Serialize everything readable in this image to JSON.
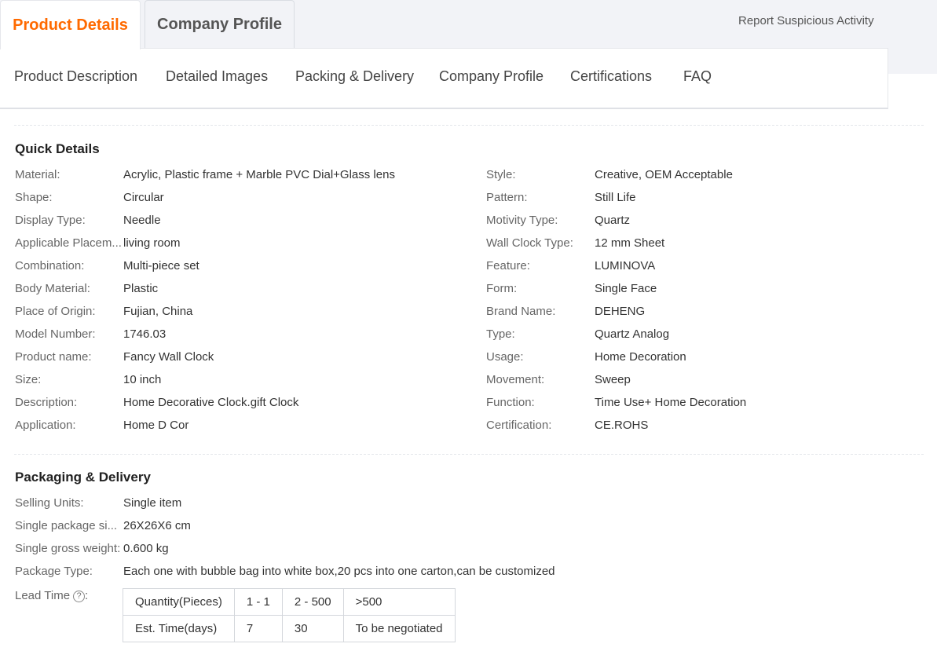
{
  "tabs": {
    "active": "Product Details",
    "inactive": "Company Profile"
  },
  "report_link": "Report Suspicious Activity",
  "sub_nav": [
    "Product Description",
    "Detailed Images",
    "Packing & Delivery",
    "Company Profile",
    "Certifications",
    "FAQ"
  ],
  "quick_details": {
    "title": "Quick Details",
    "left": [
      {
        "k": "Material:",
        "v": "Acrylic, Plastic frame + Marble PVC Dial+Glass lens"
      },
      {
        "k": "Shape:",
        "v": "Circular"
      },
      {
        "k": "Display Type:",
        "v": "Needle"
      },
      {
        "k": "Applicable Placem...",
        "v": "living room"
      },
      {
        "k": "Combination:",
        "v": "Multi-piece set"
      },
      {
        "k": "Body Material:",
        "v": "Plastic"
      },
      {
        "k": "Place of Origin:",
        "v": "Fujian, China"
      },
      {
        "k": "Model Number:",
        "v": "1746.03"
      },
      {
        "k": "Product name:",
        "v": "Fancy Wall Clock"
      },
      {
        "k": "Size:",
        "v": "10 inch"
      },
      {
        "k": "Description:",
        "v": "Home Decorative Clock.gift Clock"
      },
      {
        "k": "Application:",
        "v": "Home D Cor"
      }
    ],
    "right": [
      {
        "k": "Style:",
        "v": "Creative, OEM Acceptable"
      },
      {
        "k": "Pattern:",
        "v": "Still Life"
      },
      {
        "k": "Motivity Type:",
        "v": "Quartz"
      },
      {
        "k": "Wall Clock Type:",
        "v": "12 mm Sheet"
      },
      {
        "k": "Feature:",
        "v": "LUMINOVA"
      },
      {
        "k": "Form:",
        "v": "Single Face"
      },
      {
        "k": "Brand Name:",
        "v": "DEHENG"
      },
      {
        "k": "Type:",
        "v": "Quartz Analog"
      },
      {
        "k": "Usage:",
        "v": "Home Decoration"
      },
      {
        "k": "Movement:",
        "v": "Sweep"
      },
      {
        "k": "Function:",
        "v": "Time Use+ Home Decoration"
      },
      {
        "k": "Certification:",
        "v": "CE.ROHS"
      }
    ]
  },
  "packaging": {
    "title": "Packaging & Delivery",
    "rows": [
      {
        "k": "Selling Units:",
        "v": "Single item"
      },
      {
        "k": "Single package si...",
        "v": "26X26X6 cm"
      },
      {
        "k": "Single gross weight:",
        "v": "0.600 kg"
      },
      {
        "k": "Package Type:",
        "v": "Each one with bubble bag into white box,20 pcs into one carton,can be customized"
      }
    ],
    "lead_time_label": "Lead Time",
    "lead_time_suffix": ":",
    "help_icon": "question-circle-icon",
    "lead_table": {
      "header": [
        "Quantity(Pieces)",
        "1 - 1",
        "2 - 500",
        ">500"
      ],
      "row": [
        "Est. Time(days)",
        "7",
        "30",
        "To be negotiated"
      ]
    }
  }
}
